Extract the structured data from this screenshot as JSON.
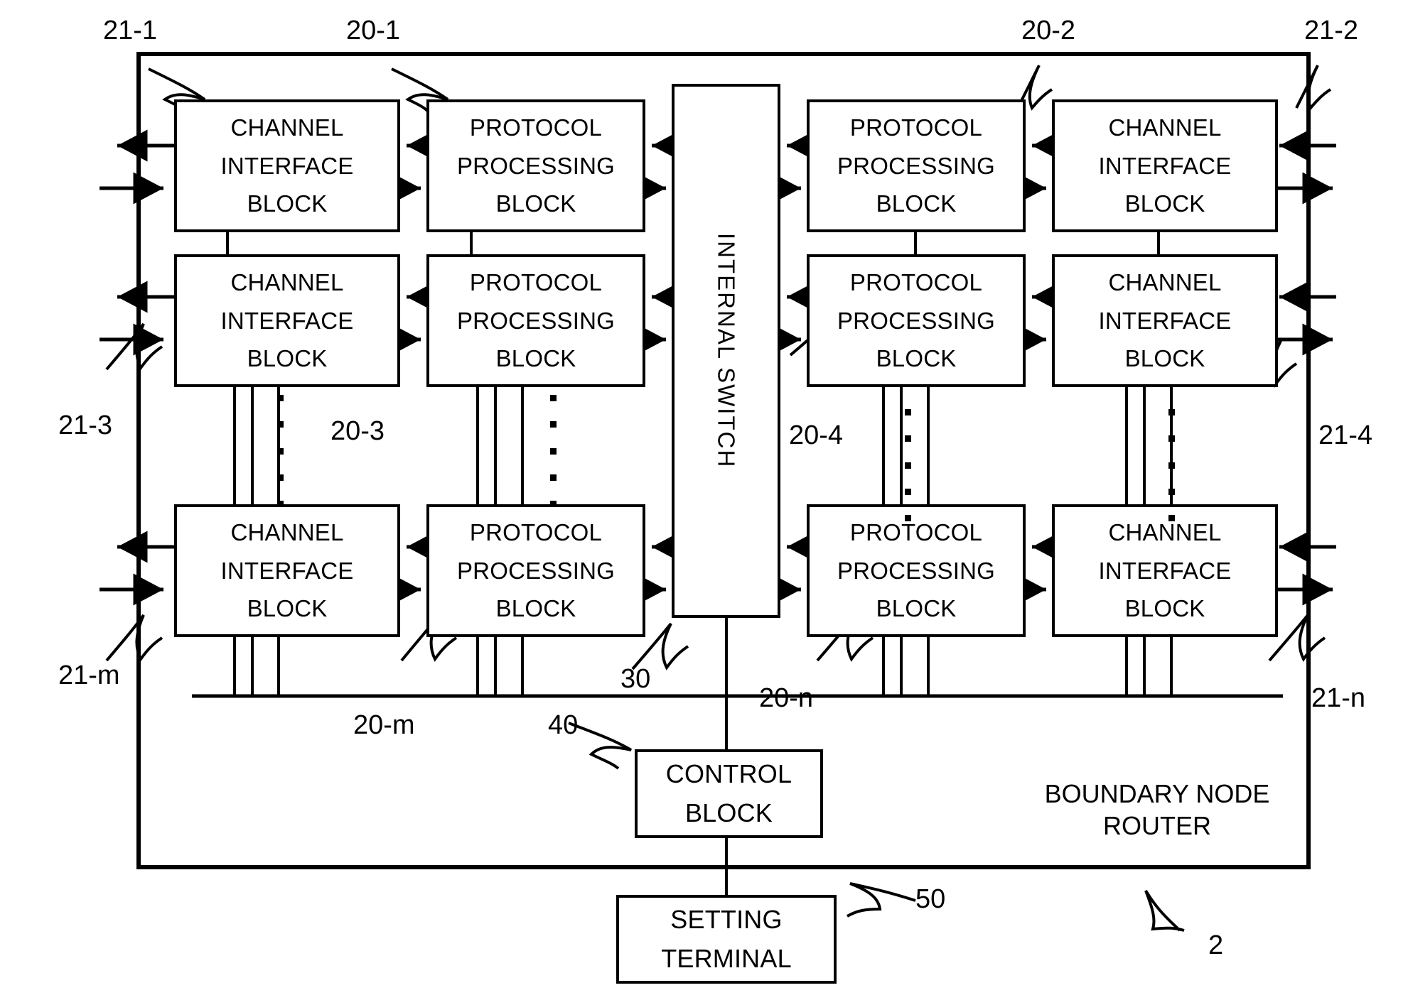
{
  "figure": {
    "title": "BOUNDARY NODE ROUTER",
    "device_ref": "2"
  },
  "blocks": {
    "channel_interface": {
      "line1": "CHANNEL",
      "line2": "INTERFACE",
      "line3": "BLOCK"
    },
    "protocol_processing": {
      "line1": "PROTOCOL",
      "line2": "PROCESSING",
      "line3": "BLOCK"
    },
    "internal_switch": {
      "label": "INTERNAL SWITCH",
      "ref": "30"
    },
    "control_block": {
      "line1": "CONTROL",
      "line2": "BLOCK",
      "ref": "40"
    },
    "setting_terminal": {
      "line1": "SETTING",
      "line2": "TERMINAL",
      "ref": "50"
    }
  },
  "reference_numerals": {
    "ci_top_left": "21-1",
    "pp_top_left": "20-1",
    "pp_top_right": "20-2",
    "ci_top_right": "21-2",
    "ci_mid_left": "21-3",
    "pp_mid_left": "20-3",
    "pp_mid_right": "20-4",
    "ci_mid_right": "21-4",
    "ci_bottom_left": "21-m",
    "pp_bottom_left": "20-m",
    "pp_bottom_right": "20-n",
    "ci_bottom_right": "21-n",
    "switch": "30",
    "control": "40",
    "terminal": "50",
    "router": "2"
  },
  "grid": {
    "rows": [
      "row-1",
      "row-2",
      "row-n"
    ],
    "columns": [
      "channel-interface-left",
      "protocol-processing-left",
      "internal-switch",
      "protocol-processing-right",
      "channel-interface-right"
    ]
  },
  "ellipsis": {
    "symbol": "vertical-dots",
    "count": 5,
    "meaning": "continuation"
  },
  "colors": {
    "line": "#000000",
    "fill": "#ffffff"
  }
}
